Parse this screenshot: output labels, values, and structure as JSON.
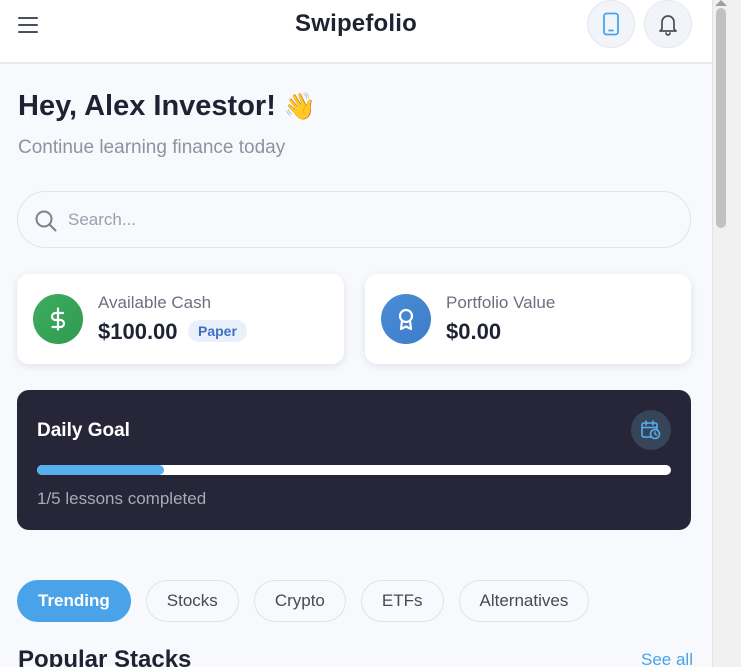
{
  "header": {
    "title": "Swipefolio",
    "menu_icon": "hamburger-menu-icon",
    "device_icon": "smartphone-icon",
    "notification_icon": "bell-icon"
  },
  "greeting": {
    "title": "Hey, Alex Investor!",
    "emoji": "👋",
    "subtitle": "Continue learning finance today"
  },
  "search": {
    "placeholder": "Search...",
    "value": "",
    "icon": "search-icon"
  },
  "cards": {
    "cash": {
      "label": "Available Cash",
      "value": "$100.00",
      "badge": "Paper",
      "icon": "dollar-icon",
      "icon_color": "#3fae60"
    },
    "portfolio": {
      "label": "Portfolio Value",
      "value": "$0.00",
      "icon": "award-icon",
      "icon_color": "#4a8ed6"
    }
  },
  "daily_goal": {
    "title": "Daily Goal",
    "icon": "calendar-clock-icon",
    "progress_fraction": 0.2,
    "status": "1/5 lessons completed",
    "background_color": "#272538",
    "progress_color": "#56b0ee"
  },
  "tabs": [
    {
      "label": "Trending",
      "active": true
    },
    {
      "label": "Stocks",
      "active": false
    },
    {
      "label": "Crypto",
      "active": false
    },
    {
      "label": "ETFs",
      "active": false
    },
    {
      "label": "Alternatives",
      "active": false
    }
  ],
  "section": {
    "title": "Popular Stacks",
    "link": "See all"
  },
  "colors": {
    "accent": "#4aa3e8",
    "background": "#f7f9fc"
  }
}
